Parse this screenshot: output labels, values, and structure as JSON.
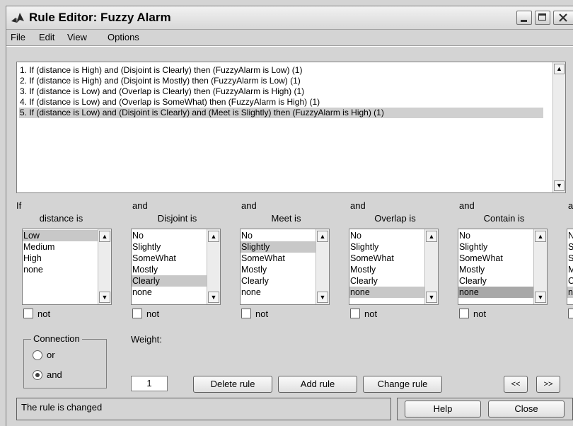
{
  "window": {
    "title": "Rule Editor: Fuzzy Alarm"
  },
  "menu": {
    "items": [
      "File",
      "Edit",
      "View",
      "Options"
    ]
  },
  "rules": [
    "1. If (distance is High) and (Disjoint is Clearly) then (FuzzyAlarm is Low) (1)",
    "2. If (distance is High) and (Disjoint is Mostly) then (FuzzyAlarm is Low) (1)",
    "3. If (distance is Low) and (Overlap is Clearly) then (FuzzyAlarm is High) (1)",
    "4. If (distance is Low) and (Overlap is SomeWhat) then (FuzzyAlarm is High) (1)",
    "5. If (distance is Low) and (Disjoint is Clearly) and (Meet is Slightly) then (FuzzyAlarm is High) (1)"
  ],
  "selected_rule": 5,
  "variables": [
    {
      "conj": "If",
      "name": "distance is",
      "options": [
        "Low",
        "Medium",
        "High",
        "none"
      ],
      "selected": "Low",
      "not_label": "not"
    },
    {
      "conj": "and",
      "name": "Disjoint is",
      "options": [
        "No",
        "Slightly",
        "SomeWhat",
        "Mostly",
        "Clearly",
        "none"
      ],
      "selected": "Clearly",
      "not_label": "not"
    },
    {
      "conj": "and",
      "name": "Meet is",
      "options": [
        "No",
        "Slightly",
        "SomeWhat",
        "Mostly",
        "Clearly",
        "none"
      ],
      "selected": "Slightly",
      "not_label": "not"
    },
    {
      "conj": "and",
      "name": "Overlap is",
      "options": [
        "No",
        "Slightly",
        "SomeWhat",
        "Mostly",
        "Clearly",
        "none"
      ],
      "selected": "none",
      "not_label": "not"
    },
    {
      "conj": "and",
      "name": "Contain is",
      "options": [
        "No",
        "Slightly",
        "SomeWhat",
        "Mostly",
        "Clearly",
        "none"
      ],
      "selected": "none",
      "not_label": "not"
    }
  ],
  "partial_column": {
    "conj": "a",
    "options": [
      "N",
      "S",
      "S",
      "M",
      "C",
      "n"
    ]
  },
  "connection": {
    "title": "Connection",
    "or_label": "or",
    "and_label": "and",
    "selected": "and"
  },
  "weight": {
    "label": "Weight:",
    "value": "1"
  },
  "buttons": {
    "delete": "Delete rule",
    "add": "Add rule",
    "change": "Change rule",
    "prev": "<<",
    "next": ">>",
    "help": "Help",
    "close": "Close"
  },
  "status": "The rule is changed",
  "icons": {
    "app": "matlab-icon",
    "scroll_up": "scroll-up-icon",
    "scroll_down": "scroll-down-icon"
  }
}
